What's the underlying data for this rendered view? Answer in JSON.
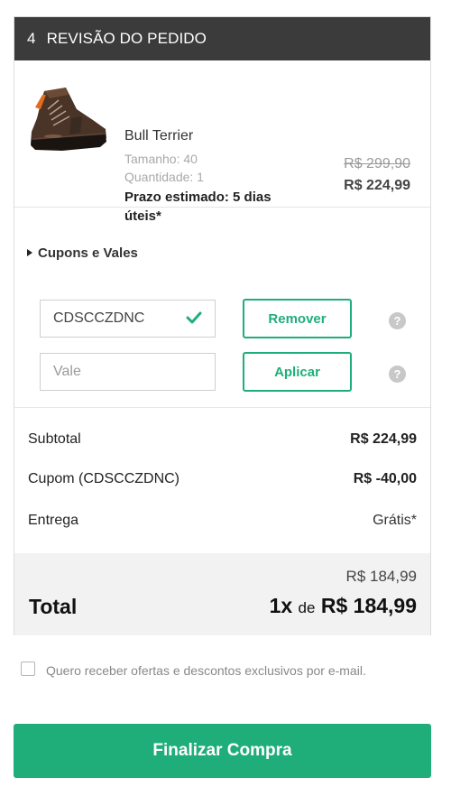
{
  "header": {
    "step": "4",
    "title": "REVISÃO DO PEDIDO"
  },
  "product": {
    "name": "Bull Terrier",
    "size": "Tamanho: 40",
    "quantity": "Quantidade: 1",
    "eta": "Prazo estimado: 5 dias úteis*",
    "price_old": "R$ 299,90",
    "price_new": "R$ 224,99",
    "image_icon": "shoe-image"
  },
  "coupons": {
    "title": "Cupons e Vales",
    "coupon_value": "CDSCCZDNC",
    "voucher_placeholder": "Vale",
    "remove_label": "Remover",
    "apply_label": "Aplicar",
    "help_glyph": "?"
  },
  "summary": {
    "subtotal_label": "Subtotal",
    "subtotal_value": "R$ 224,99",
    "coupon_label": "Cupom (CDSCCZDNC)",
    "coupon_value": "R$ -40,00",
    "shipping_label": "Entrega",
    "shipping_value": "Grátis*"
  },
  "total": {
    "sub_amount": "R$ 184,99",
    "label": "Total",
    "installments": "1x",
    "de": "de",
    "amount": "R$ 184,99"
  },
  "optin": {
    "text": "Quero receber ofertas e descontos exclusivos por e-mail."
  },
  "cta": {
    "label": "Finalizar Compra"
  },
  "colors": {
    "accent": "#1fae7a",
    "header_bg": "#3b3b3b",
    "total_bg": "#f2f2f2"
  }
}
